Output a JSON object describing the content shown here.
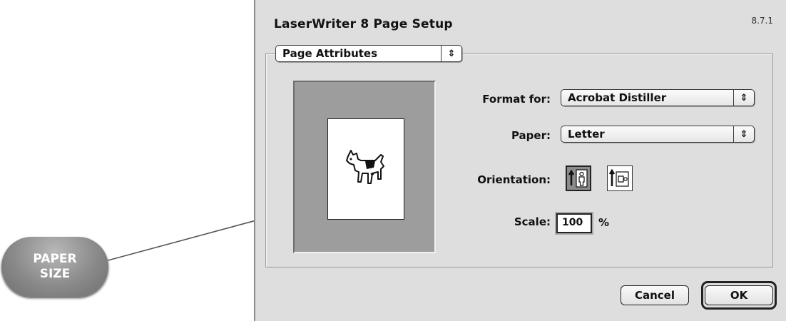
{
  "dialog": {
    "title": "LaserWriter 8 Page Setup",
    "version": "8.7.1",
    "sheet_selector": "Page Attributes",
    "format_for": {
      "label": "Format for:",
      "value": "Acrobat Distiller"
    },
    "paper": {
      "label": "Paper:",
      "value": "Letter"
    },
    "orientation": {
      "label": "Orientation:",
      "options": [
        "portrait",
        "landscape"
      ],
      "selected": "portrait"
    },
    "scale": {
      "label": "Scale:",
      "value": "100",
      "unit": "%"
    },
    "buttons": {
      "cancel": "Cancel",
      "ok": "OK"
    }
  },
  "callout": {
    "line1": "PAPER",
    "line2": "SIZE"
  },
  "colors": {
    "dialog_bg": "#dedede",
    "badge": "#8a8a8a"
  }
}
